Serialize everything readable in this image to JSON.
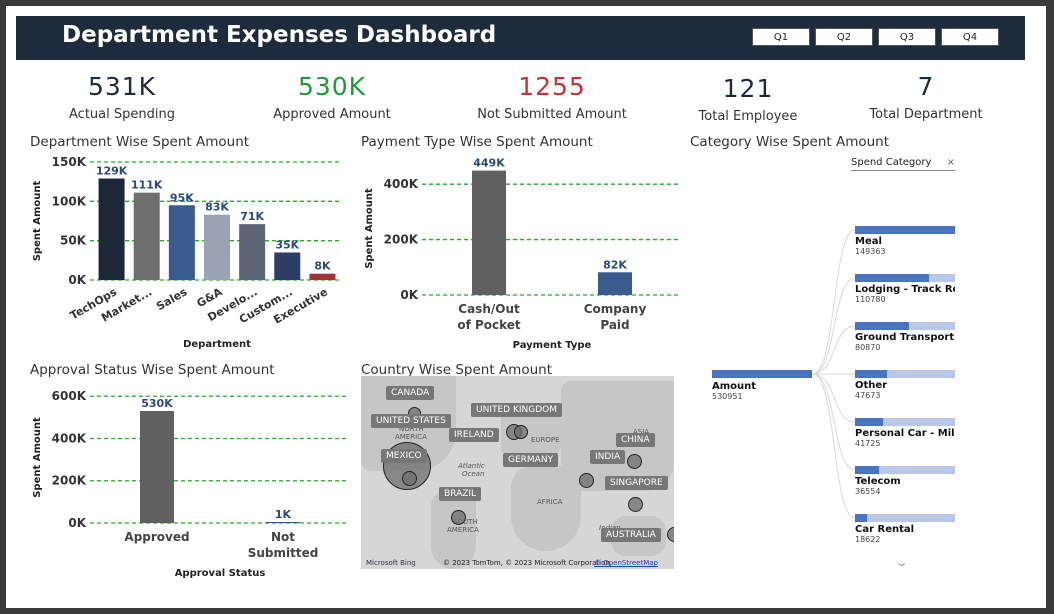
{
  "header": {
    "title": "Department Expenses Dashboard",
    "quarters": [
      "Q1",
      "Q2",
      "Q3",
      "Q4"
    ]
  },
  "kpis": [
    {
      "value": "531K",
      "label": "Actual Spending",
      "color": "#1e2b3c"
    },
    {
      "value": "530K",
      "label": "Approved Amount",
      "color": "#1f9a3a"
    },
    {
      "value": "1255",
      "label": "Not Submitted Amount",
      "color": "#c8303a"
    },
    {
      "value": "121",
      "label": "Total Employee",
      "color": "#1e2b3c"
    },
    {
      "value": "7",
      "label": "Total Department",
      "color": "#1e2b3c"
    }
  ],
  "sections": {
    "dept": "Department Wise Spent Amount",
    "payment": "Payment Type Wise Spent Amount",
    "category": "Category Wise Spent Amount",
    "approval": "Approval Status Wise Spent Amount",
    "country": "Country Wise Spent Amount"
  },
  "chart_data": [
    {
      "type": "bar",
      "title": "Department Wise Spent Amount",
      "categories": [
        "TechOps",
        "Market...",
        "Sales",
        "G&A",
        "Develo...",
        "Custom...",
        "Executive"
      ],
      "values": [
        129000,
        111000,
        95000,
        83000,
        71000,
        35000,
        8000
      ],
      "data_labels": [
        "129K",
        "111K",
        "95K",
        "83K",
        "71K",
        "35K",
        "8K"
      ],
      "colors": [
        "#1c2737",
        "#6e6e6e",
        "#3b5a8e",
        "#9aa3b4",
        "#5d6677",
        "#2c3e66",
        "#a2333a"
      ],
      "xlabel": "Department",
      "ylabel": "Spent Amount",
      "ylim": [
        0,
        150000
      ],
      "yticks": [
        "0K",
        "50K",
        "100K",
        "150K"
      ],
      "grid": true
    },
    {
      "type": "bar",
      "title": "Payment Type Wise Spent Amount",
      "categories": [
        "Cash/Out of Pocket",
        "Company Paid"
      ],
      "category_lines": [
        [
          "Cash/Out",
          "of Pocket"
        ],
        [
          "Company",
          "Paid"
        ]
      ],
      "values": [
        449000,
        82000
      ],
      "data_labels": [
        "449K",
        "82K"
      ],
      "colors": [
        "#606060",
        "#3b5a8e"
      ],
      "xlabel": "Payment Type",
      "ylabel": "Spent Amount",
      "ylim": [
        0,
        480000
      ],
      "yticks": [
        "0K",
        "200K",
        "400K"
      ],
      "grid": true
    },
    {
      "type": "bar",
      "title": "Approval Status Wise Spent Amount",
      "categories": [
        "Approved",
        "Not Submitted"
      ],
      "category_lines": [
        [
          "Approved"
        ],
        [
          "Not",
          "Submitted"
        ]
      ],
      "values": [
        530000,
        1255
      ],
      "data_labels": [
        "530K",
        "1K"
      ],
      "colors": [
        "#606060",
        "#3b5a8e"
      ],
      "xlabel": "Approval Status",
      "ylabel": "Spent Amount",
      "ylim": [
        0,
        620000
      ],
      "yticks": [
        "0K",
        "200K",
        "400K",
        "600K"
      ],
      "grid": true
    }
  ],
  "map": {
    "countries": [
      "CANADA",
      "UNITED STATES",
      "MEXICO",
      "BRAZIL",
      "UNITED KINGDOM",
      "IRELAND",
      "GERMANY",
      "CHINA",
      "INDIA",
      "SINGAPORE",
      "AUSTRALIA"
    ],
    "overlay_text": [
      "NORTH",
      "AMERICA",
      "EUROPE",
      "ASIA",
      "Atlantic",
      "Ocean",
      "AFRICA",
      "SOUTH",
      "AMERICA",
      "Indian"
    ],
    "logo": "Microsoft Bing",
    "copyright": "© 2023 TomTom, © 2023 Microsoft Corporation,",
    "osm_link": "© OpenStreetMap"
  },
  "decomp_tree": {
    "slicer_label": "Spend Category",
    "root": {
      "label": "Amount",
      "value": "530951"
    },
    "items": [
      {
        "name": "Meal",
        "value": "149363",
        "amount": 149363
      },
      {
        "name": "Lodging - Track Ro...",
        "value": "110780",
        "amount": 110780
      },
      {
        "name": "Ground Transport...",
        "value": "80870",
        "amount": 80870
      },
      {
        "name": "Other",
        "value": "47673",
        "amount": 47673
      },
      {
        "name": "Personal Car - Mil...",
        "value": "41725",
        "amount": 41725
      },
      {
        "name": "Telecom",
        "value": "36554",
        "amount": 36554
      },
      {
        "name": "Car Rental",
        "value": "18622",
        "amount": 18622
      }
    ]
  }
}
